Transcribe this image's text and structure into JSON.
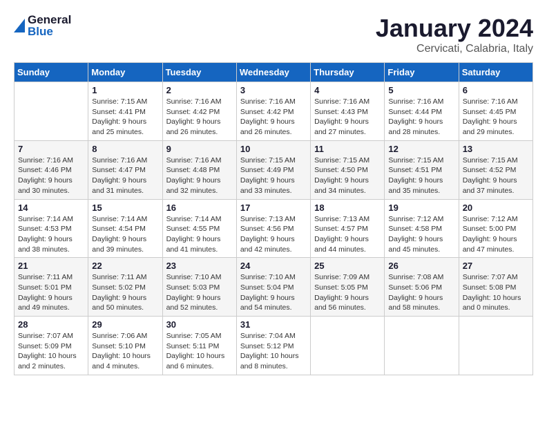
{
  "header": {
    "logo_general": "General",
    "logo_blue": "Blue",
    "title": "January 2024",
    "subtitle": "Cervicati, Calabria, Italy"
  },
  "days_of_week": [
    "Sunday",
    "Monday",
    "Tuesday",
    "Wednesday",
    "Thursday",
    "Friday",
    "Saturday"
  ],
  "weeks": [
    [
      {
        "day": "",
        "info": ""
      },
      {
        "day": "1",
        "info": "Sunrise: 7:15 AM\nSunset: 4:41 PM\nDaylight: 9 hours\nand 25 minutes."
      },
      {
        "day": "2",
        "info": "Sunrise: 7:16 AM\nSunset: 4:42 PM\nDaylight: 9 hours\nand 26 minutes."
      },
      {
        "day": "3",
        "info": "Sunrise: 7:16 AM\nSunset: 4:42 PM\nDaylight: 9 hours\nand 26 minutes."
      },
      {
        "day": "4",
        "info": "Sunrise: 7:16 AM\nSunset: 4:43 PM\nDaylight: 9 hours\nand 27 minutes."
      },
      {
        "day": "5",
        "info": "Sunrise: 7:16 AM\nSunset: 4:44 PM\nDaylight: 9 hours\nand 28 minutes."
      },
      {
        "day": "6",
        "info": "Sunrise: 7:16 AM\nSunset: 4:45 PM\nDaylight: 9 hours\nand 29 minutes."
      }
    ],
    [
      {
        "day": "7",
        "info": "Sunrise: 7:16 AM\nSunset: 4:46 PM\nDaylight: 9 hours\nand 30 minutes."
      },
      {
        "day": "8",
        "info": "Sunrise: 7:16 AM\nSunset: 4:47 PM\nDaylight: 9 hours\nand 31 minutes."
      },
      {
        "day": "9",
        "info": "Sunrise: 7:16 AM\nSunset: 4:48 PM\nDaylight: 9 hours\nand 32 minutes."
      },
      {
        "day": "10",
        "info": "Sunrise: 7:15 AM\nSunset: 4:49 PM\nDaylight: 9 hours\nand 33 minutes."
      },
      {
        "day": "11",
        "info": "Sunrise: 7:15 AM\nSunset: 4:50 PM\nDaylight: 9 hours\nand 34 minutes."
      },
      {
        "day": "12",
        "info": "Sunrise: 7:15 AM\nSunset: 4:51 PM\nDaylight: 9 hours\nand 35 minutes."
      },
      {
        "day": "13",
        "info": "Sunrise: 7:15 AM\nSunset: 4:52 PM\nDaylight: 9 hours\nand 37 minutes."
      }
    ],
    [
      {
        "day": "14",
        "info": "Sunrise: 7:14 AM\nSunset: 4:53 PM\nDaylight: 9 hours\nand 38 minutes."
      },
      {
        "day": "15",
        "info": "Sunrise: 7:14 AM\nSunset: 4:54 PM\nDaylight: 9 hours\nand 39 minutes."
      },
      {
        "day": "16",
        "info": "Sunrise: 7:14 AM\nSunset: 4:55 PM\nDaylight: 9 hours\nand 41 minutes."
      },
      {
        "day": "17",
        "info": "Sunrise: 7:13 AM\nSunset: 4:56 PM\nDaylight: 9 hours\nand 42 minutes."
      },
      {
        "day": "18",
        "info": "Sunrise: 7:13 AM\nSunset: 4:57 PM\nDaylight: 9 hours\nand 44 minutes."
      },
      {
        "day": "19",
        "info": "Sunrise: 7:12 AM\nSunset: 4:58 PM\nDaylight: 9 hours\nand 45 minutes."
      },
      {
        "day": "20",
        "info": "Sunrise: 7:12 AM\nSunset: 5:00 PM\nDaylight: 9 hours\nand 47 minutes."
      }
    ],
    [
      {
        "day": "21",
        "info": "Sunrise: 7:11 AM\nSunset: 5:01 PM\nDaylight: 9 hours\nand 49 minutes."
      },
      {
        "day": "22",
        "info": "Sunrise: 7:11 AM\nSunset: 5:02 PM\nDaylight: 9 hours\nand 50 minutes."
      },
      {
        "day": "23",
        "info": "Sunrise: 7:10 AM\nSunset: 5:03 PM\nDaylight: 9 hours\nand 52 minutes."
      },
      {
        "day": "24",
        "info": "Sunrise: 7:10 AM\nSunset: 5:04 PM\nDaylight: 9 hours\nand 54 minutes."
      },
      {
        "day": "25",
        "info": "Sunrise: 7:09 AM\nSunset: 5:05 PM\nDaylight: 9 hours\nand 56 minutes."
      },
      {
        "day": "26",
        "info": "Sunrise: 7:08 AM\nSunset: 5:06 PM\nDaylight: 9 hours\nand 58 minutes."
      },
      {
        "day": "27",
        "info": "Sunrise: 7:07 AM\nSunset: 5:08 PM\nDaylight: 10 hours\nand 0 minutes."
      }
    ],
    [
      {
        "day": "28",
        "info": "Sunrise: 7:07 AM\nSunset: 5:09 PM\nDaylight: 10 hours\nand 2 minutes."
      },
      {
        "day": "29",
        "info": "Sunrise: 7:06 AM\nSunset: 5:10 PM\nDaylight: 10 hours\nand 4 minutes."
      },
      {
        "day": "30",
        "info": "Sunrise: 7:05 AM\nSunset: 5:11 PM\nDaylight: 10 hours\nand 6 minutes."
      },
      {
        "day": "31",
        "info": "Sunrise: 7:04 AM\nSunset: 5:12 PM\nDaylight: 10 hours\nand 8 minutes."
      },
      {
        "day": "",
        "info": ""
      },
      {
        "day": "",
        "info": ""
      },
      {
        "day": "",
        "info": ""
      }
    ]
  ]
}
